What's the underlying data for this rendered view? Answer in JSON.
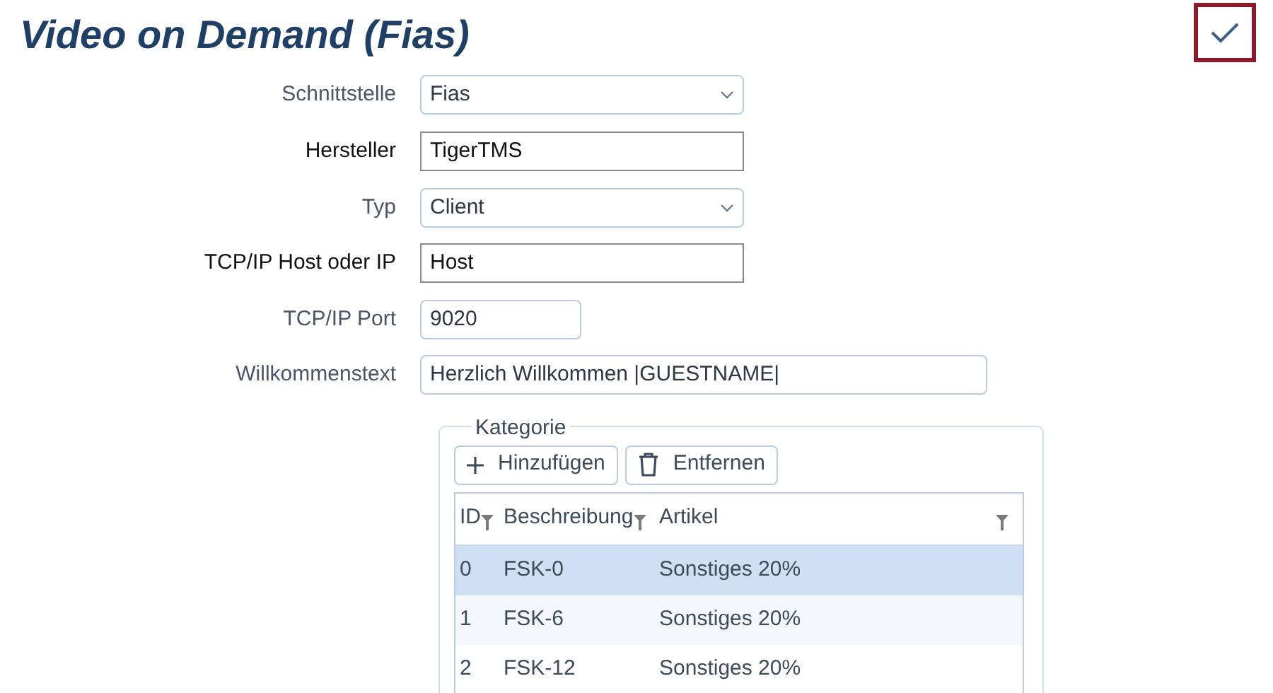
{
  "title": "Video on Demand (Fias)",
  "fields": [
    {
      "label": "Schnittstelle",
      "kind": "select",
      "value": "Fias"
    },
    {
      "label": "Hersteller",
      "kind": "plain",
      "value": "TigerTMS"
    },
    {
      "label": "Typ",
      "kind": "select",
      "value": "Client"
    },
    {
      "label": "TCP/IP Host oder IP",
      "kind": "plain",
      "value": "Host"
    },
    {
      "label": "TCP/IP Port",
      "kind": "input",
      "value": "9020"
    },
    {
      "label": "Willkommenstext",
      "kind": "input",
      "value": "Herzlich Willkommen |GUESTNAME|"
    }
  ],
  "category": {
    "legend": "Kategorie",
    "buttons": [
      {
        "label": "Hinzufügen",
        "kind": "add"
      },
      {
        "label": "Entfernen",
        "kind": "delete"
      }
    ],
    "columns": [
      "ID",
      "Beschreibung",
      "Artikel"
    ],
    "rows": [
      {
        "cells": [
          "0",
          "FSK-0",
          "Sonstiges 20%"
        ],
        "selected": true
      },
      {
        "cells": [
          "1",
          "FSK-6",
          "Sonstiges 20%"
        ],
        "selected": false
      },
      {
        "cells": [
          "2",
          "FSK-12",
          "Sonstiges 20%"
        ],
        "selected": false
      }
    ]
  }
}
